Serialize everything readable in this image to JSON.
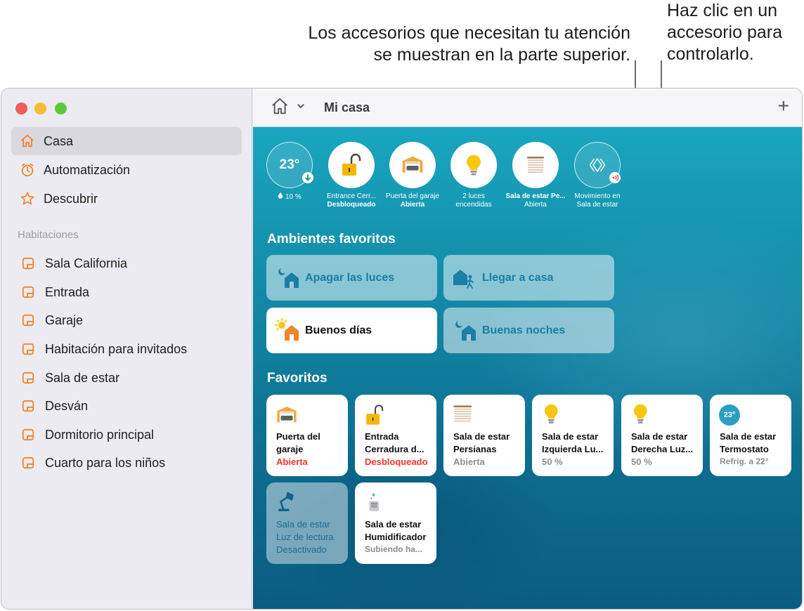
{
  "callouts": {
    "left_line1": "Los accesorios que necesitan tu atención",
    "left_line2": "se muestran en la parte superior.",
    "right_line1": "Haz clic en un",
    "right_line2": "accesorio para",
    "right_line3": "controlarlo."
  },
  "sidebar": {
    "nav": [
      {
        "label": "Casa",
        "icon": "house-icon",
        "active": true
      },
      {
        "label": "Automatización",
        "icon": "clock-icon",
        "active": false
      },
      {
        "label": "Descubrir",
        "icon": "star-icon",
        "active": false
      }
    ],
    "rooms_label": "Habitaciones",
    "rooms": [
      "Sala California",
      "Entrada",
      "Garaje",
      "Habitación para invitados",
      "Sala de estar",
      "Desván",
      "Dormitorio principal",
      "Cuarto para los niños"
    ]
  },
  "header": {
    "home_title": "Mi casa",
    "add_label": "+"
  },
  "status": {
    "thermostat_temp": "23°",
    "humidity": "10 %",
    "items": [
      {
        "name": "Entrance Cerr...",
        "state": "Desbloqueado",
        "icon": "lock-open-icon"
      },
      {
        "name": "Puerta del garaje",
        "state": "Abierta",
        "icon": "garage-icon"
      },
      {
        "name": "2 luces",
        "state": "encendidas",
        "icon": "bulb-icon"
      },
      {
        "name": "Sala de estar Pe...",
        "state": "Abierta",
        "icon": "blinds-icon"
      },
      {
        "name": "Movimiento en",
        "state": "Sala de estar",
        "icon": "motion-sensor-icon"
      }
    ]
  },
  "scenes_heading": "Ambientes favoritos",
  "scenes": [
    {
      "label": "Apagar las luces",
      "icon": "scene-night-icon",
      "active": false
    },
    {
      "label": "Llegar a casa",
      "icon": "scene-arrive-icon",
      "active": false
    },
    {
      "label": "Buenos días",
      "icon": "scene-sun-icon",
      "active": true
    },
    {
      "label": "Buenas noches",
      "icon": "scene-night-icon",
      "active": false
    }
  ],
  "favorites_heading": "Favoritos",
  "favorites": [
    {
      "l1": "Puerta del",
      "l2": "garaje",
      "status": "Abierta",
      "alert": true,
      "icon": "garage-icon"
    },
    {
      "l1": "Entrada",
      "l2": "Cerradura d...",
      "status": "Desbloqueado",
      "alert": true,
      "icon": "lock-open-icon"
    },
    {
      "l1": "Sala de estar",
      "l2": "Persianas",
      "status": "Abierta",
      "alert": false,
      "icon": "blinds-icon"
    },
    {
      "l1": "Sala de estar",
      "l2": "Izquierda Lu...",
      "status": "50 %",
      "alert": false,
      "icon": "bulb-icon"
    },
    {
      "l1": "Sala de estar",
      "l2": "Derecha Luz...",
      "status": "50 %",
      "alert": false,
      "icon": "bulb-icon"
    },
    {
      "l1": "Sala de estar",
      "l2": "Termostato",
      "status": "Refrig. a 22°",
      "alert": false,
      "icon": "thermostat-icon",
      "badge": "23°"
    },
    {
      "l1": "Sala de estar",
      "l2": "Luz de lectura",
      "status": "Desactivado",
      "alert": false,
      "icon": "desk-lamp-icon",
      "off": true
    },
    {
      "l1": "Sala de estar",
      "l2": "Humidificador",
      "status": "Subiendo ha...",
      "alert": false,
      "icon": "humidifier-icon"
    }
  ],
  "colors": {
    "accent_orange": "#f0852b",
    "alert_red": "#f0342c",
    "bulb_yellow": "#f7c70f",
    "background_teal": "#138eaa"
  }
}
